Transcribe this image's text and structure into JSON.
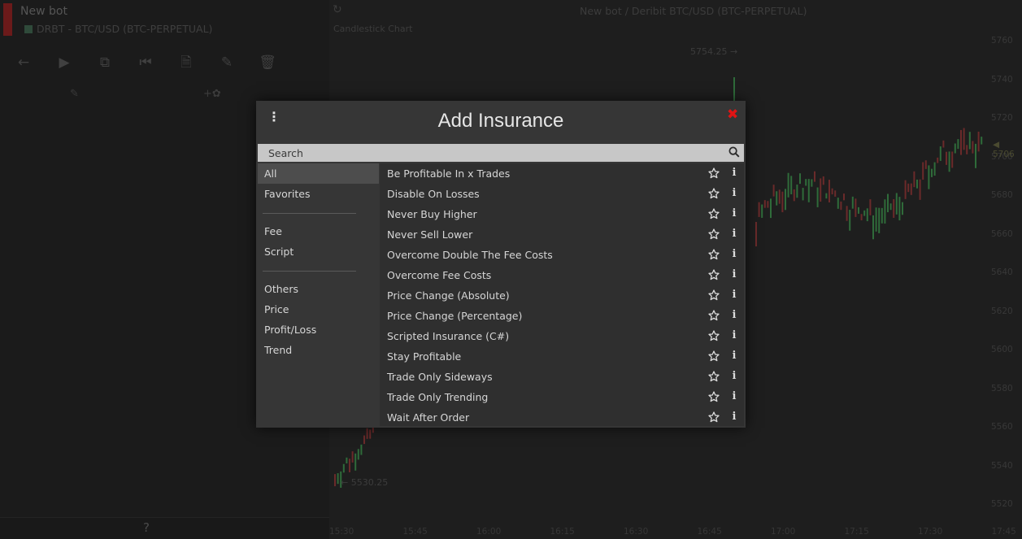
{
  "background": {
    "bot": {
      "name": "New bot",
      "pair": "DRBT - BTC/USD (BTC-PERPETUAL)"
    },
    "toolbar_icons": [
      "back-icon",
      "play-icon",
      "clone-icon",
      "rewind-icon",
      "file-icon",
      "eraser-icon",
      "trash-icon"
    ],
    "help_label": "?",
    "chart": {
      "title": "New bot / Deribit BTC/USD (BTC-PERPETUAL)",
      "subtitle": "Candlestick Chart",
      "high_label": "5754.25",
      "low_label": "5530.25",
      "last_price": "5706",
      "y_ticks": [
        "5760",
        "5740",
        "5720",
        "5700",
        "5680",
        "5660",
        "5640",
        "5620",
        "5600",
        "5580",
        "5560",
        "5540",
        "5520"
      ],
      "x_ticks": [
        "15:30",
        "15:45",
        "16:00",
        "16:15",
        "16:30",
        "16:45",
        "17:00",
        "17:15",
        "17:30",
        "17:45"
      ],
      "colors": {
        "up": "#2f6b3a",
        "down": "#6b2a2a",
        "accent": "#5a5a1e"
      }
    }
  },
  "modal": {
    "title": "Add Insurance",
    "search": {
      "placeholder": "Search",
      "value": ""
    },
    "categories": {
      "group1": [
        "All",
        "Favorites"
      ],
      "group2": [
        "Fee",
        "Script"
      ],
      "group3": [
        "Others",
        "Price",
        "Profit/Loss",
        "Trend"
      ],
      "active": "All"
    },
    "items": [
      "Be Profitable In x Trades",
      "Disable On Losses",
      "Never Buy Higher",
      "Never Sell Lower",
      "Overcome Double The Fee Costs",
      "Overcome Fee Costs",
      "Price Change (Absolute)",
      "Price Change (Percentage)",
      "Scripted Insurance (C#)",
      "Stay Profitable",
      "Trade Only Sideways",
      "Trade Only Trending",
      "Wait After Order"
    ],
    "icons": {
      "menu": "vertical-dots-icon",
      "close": "close-icon",
      "favorite": "star-outline-icon",
      "info": "info-icon"
    },
    "colors": {
      "close": "#e01414",
      "active_category": "#4d4d4d",
      "search_bg": "#c7c7c7"
    }
  }
}
